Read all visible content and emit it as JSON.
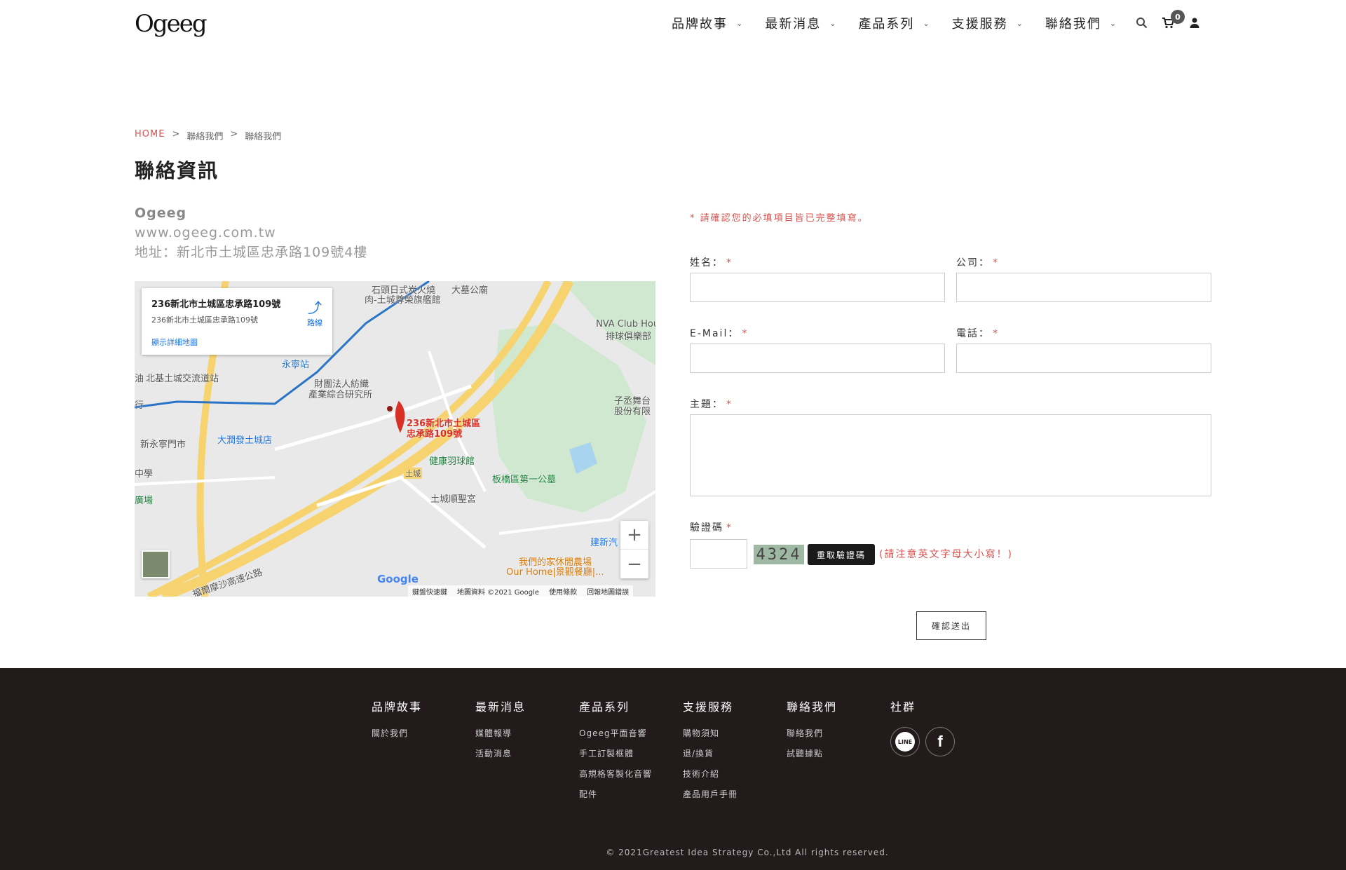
{
  "header": {
    "logo": "Ogeeg",
    "nav": [
      "品牌故事",
      "最新消息",
      "產品系列",
      "支援服務",
      "聯絡我們"
    ],
    "cart_count": "0"
  },
  "breadcrumb": [
    "HOME",
    "聯絡我們",
    "聯絡我們"
  ],
  "page_title": "聯絡資訊",
  "info": {
    "company": "Ogeeg",
    "website": "www.ogeeg.com.tw",
    "address": "地址：新北市土城區忠承路109號4樓"
  },
  "map": {
    "card_title": "236新北市土城區忠承路109號",
    "card_sub": "236新北市土城區忠承路109號",
    "card_link": "顯示詳細地圖",
    "directions": "路線",
    "pin_label_1": "236新北市土城區",
    "pin_label_2": "忠承路109號",
    "labels": [
      "石頭日式炭火燒",
      "肉-土城尊榮旗艦館",
      "大墓公廟",
      "NVA Club Hou",
      "排球俱樂部",
      "永寧站",
      "財團法人紡織",
      "產業綜合研究所",
      "北基土城交流道站",
      "子丞舞台",
      "股份有限",
      "新永寧門市",
      "大潤發土城店",
      "健康羽球館",
      "板橋區第一公墓",
      "土城",
      "土城順聖宮",
      "建新汽",
      "我們的家休閒農場",
      "Our Home|景觀餐廳|...",
      "福爾摩沙高速公路",
      "中學",
      "廣場",
      "行",
      "油"
    ],
    "google": "Google",
    "footer": [
      "鍵盤快速鍵",
      "地圖資料 ©2021 Google",
      "使用條款",
      "回報地圖錯誤"
    ]
  },
  "form": {
    "required_note": "* 請確認您的必填項目皆已完整填寫。",
    "labels": {
      "name": "姓名：",
      "company": "公司：",
      "email": "E-Mail：",
      "phone": "電話：",
      "subject": "主題：",
      "captcha": "驗證碼"
    },
    "star": "*",
    "captcha_code": "4324",
    "captcha_refresh": "重取驗證碼",
    "captcha_note": "(請注意英文字母大小寫！)",
    "submit": "確認送出"
  },
  "footer": {
    "columns": [
      {
        "title": "品牌故事",
        "links": [
          "關於我們"
        ]
      },
      {
        "title": "最新消息",
        "links": [
          "媒體報導",
          "活動消息"
        ]
      },
      {
        "title": "產品系列",
        "links": [
          "Ogeeg平面音響",
          "手工訂製框體",
          "高規格客製化音響",
          "配件"
        ]
      },
      {
        "title": "支援服務",
        "links": [
          "購物須知",
          "退/換貨",
          "技術介紹",
          "產品用戶手冊"
        ]
      },
      {
        "title": "聯絡我們",
        "links": [
          "聯絡我們",
          "試聽據點"
        ]
      }
    ],
    "social_title": "社群",
    "line_label": "LINE",
    "facebook_label": "f",
    "copyright": "© 2021Greatest Idea Strategy Co.,Ltd All rights reserved."
  }
}
